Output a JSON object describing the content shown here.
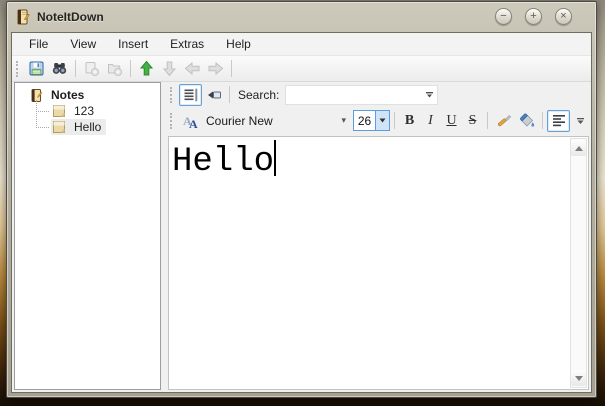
{
  "window": {
    "title": "NoteItDown",
    "controls": {
      "minimize_glyph": "−",
      "maximize_glyph": "+",
      "close_glyph": "×"
    }
  },
  "menu": {
    "items": [
      "File",
      "View",
      "Insert",
      "Extras",
      "Help"
    ]
  },
  "main_toolbar": {
    "icons": [
      "save-icon",
      "find-icon",
      "new-note-icon",
      "new-folder-icon",
      "move-up-icon",
      "move-down-icon",
      "back-icon",
      "forward-icon"
    ],
    "disabled": [
      "new-note-icon",
      "new-folder-icon",
      "move-down-icon",
      "back-icon",
      "forward-icon"
    ]
  },
  "tree": {
    "root_label": "Notes",
    "items": [
      {
        "label": "123",
        "selected": false
      },
      {
        "label": "Hello",
        "selected": true
      }
    ]
  },
  "note_toolbar": {
    "search_label": "Search:",
    "search_value": ""
  },
  "format_toolbar": {
    "font_name": "Courier New",
    "font_size": "26",
    "bold_label": "B",
    "italic_label": "I",
    "underline_label": "U",
    "strikethrough_label": "S"
  },
  "editor": {
    "text": "Hello"
  },
  "colors": {
    "accent_blue": "#67a1d4",
    "size_spin_fill": "#cfe4f7",
    "green_arrow": "#3aa83a",
    "titlebar_tan": "#b5b0a1",
    "client_bg": "#f0f0f0",
    "selection_bg": "#ececec"
  }
}
